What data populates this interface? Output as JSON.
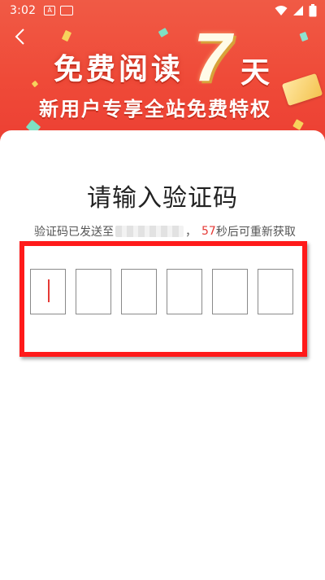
{
  "status_bar": {
    "time": "3:02",
    "left_icons": [
      "A",
      "keyboard"
    ],
    "right_icons": [
      "wifi-icon",
      "signal-icon",
      "battery-icon"
    ]
  },
  "banner": {
    "title": "免费阅读",
    "big_number": "7",
    "unit": "天",
    "subtitle": "新用户专享全站免费特权",
    "colors": {
      "background": "#ef4a38",
      "accent_gold": "#f4c34f"
    }
  },
  "card": {
    "title": "请输入验证码",
    "sent_prefix": "验证码已发送至",
    "sent_comma": "，",
    "countdown_number": "57",
    "countdown_suffix": "秒后可重新获取"
  },
  "code_input": {
    "length": 6,
    "values": [
      "",
      "",
      "",
      "",
      "",
      ""
    ],
    "active_index": 0,
    "caret_color": "#e53935"
  },
  "annotation": {
    "highlight_color": "#ff1a1a"
  }
}
